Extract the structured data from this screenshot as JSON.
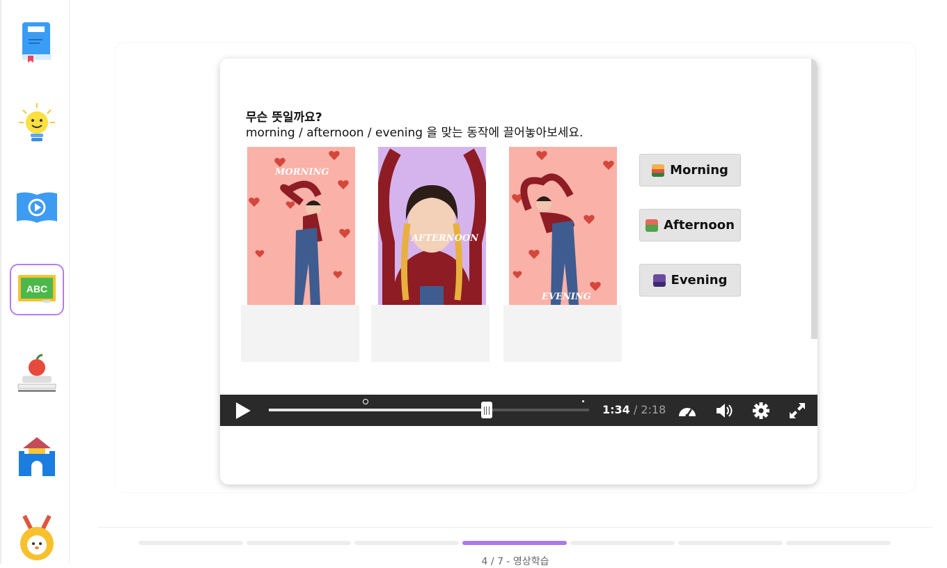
{
  "sidebar": {
    "items": [
      {
        "name": "book-icon",
        "active": false
      },
      {
        "name": "lightbulb-icon",
        "active": false
      },
      {
        "name": "video-book-icon",
        "active": false
      },
      {
        "name": "abc-board-icon",
        "active": true
      },
      {
        "name": "apple-desk-icon",
        "active": false
      },
      {
        "name": "castle-icon",
        "active": false
      },
      {
        "name": "medal-icon",
        "active": false
      }
    ]
  },
  "question": {
    "title": "무슨 뜻일까요?",
    "instruction": "morning / afternoon / evening 을 맞는 동작에 끌어놓아보세요."
  },
  "images": [
    {
      "caption": "Morning",
      "bg": "#f9b1a8"
    },
    {
      "caption": "Afternoon",
      "bg": "#d5b4ee"
    },
    {
      "caption": "Evening",
      "bg": "#f9b1a8"
    }
  ],
  "options": [
    {
      "label": "Morning",
      "icon": "sunrise-icon",
      "color": "#e2563d"
    },
    {
      "label": "Afternoon",
      "icon": "house-icon",
      "color": "#4fa34b"
    },
    {
      "label": "Evening",
      "icon": "night-city-icon",
      "color": "#6b4aa0"
    }
  ],
  "player": {
    "current_time": "1:34",
    "separator": " / ",
    "duration": "2:18",
    "progress": 0.68
  },
  "progress": {
    "current": 4,
    "total": 7,
    "label": "4 / 7 - 영상학습"
  },
  "colors": {
    "accent": "#a97bea",
    "player_bg": "#2a2a2a"
  }
}
